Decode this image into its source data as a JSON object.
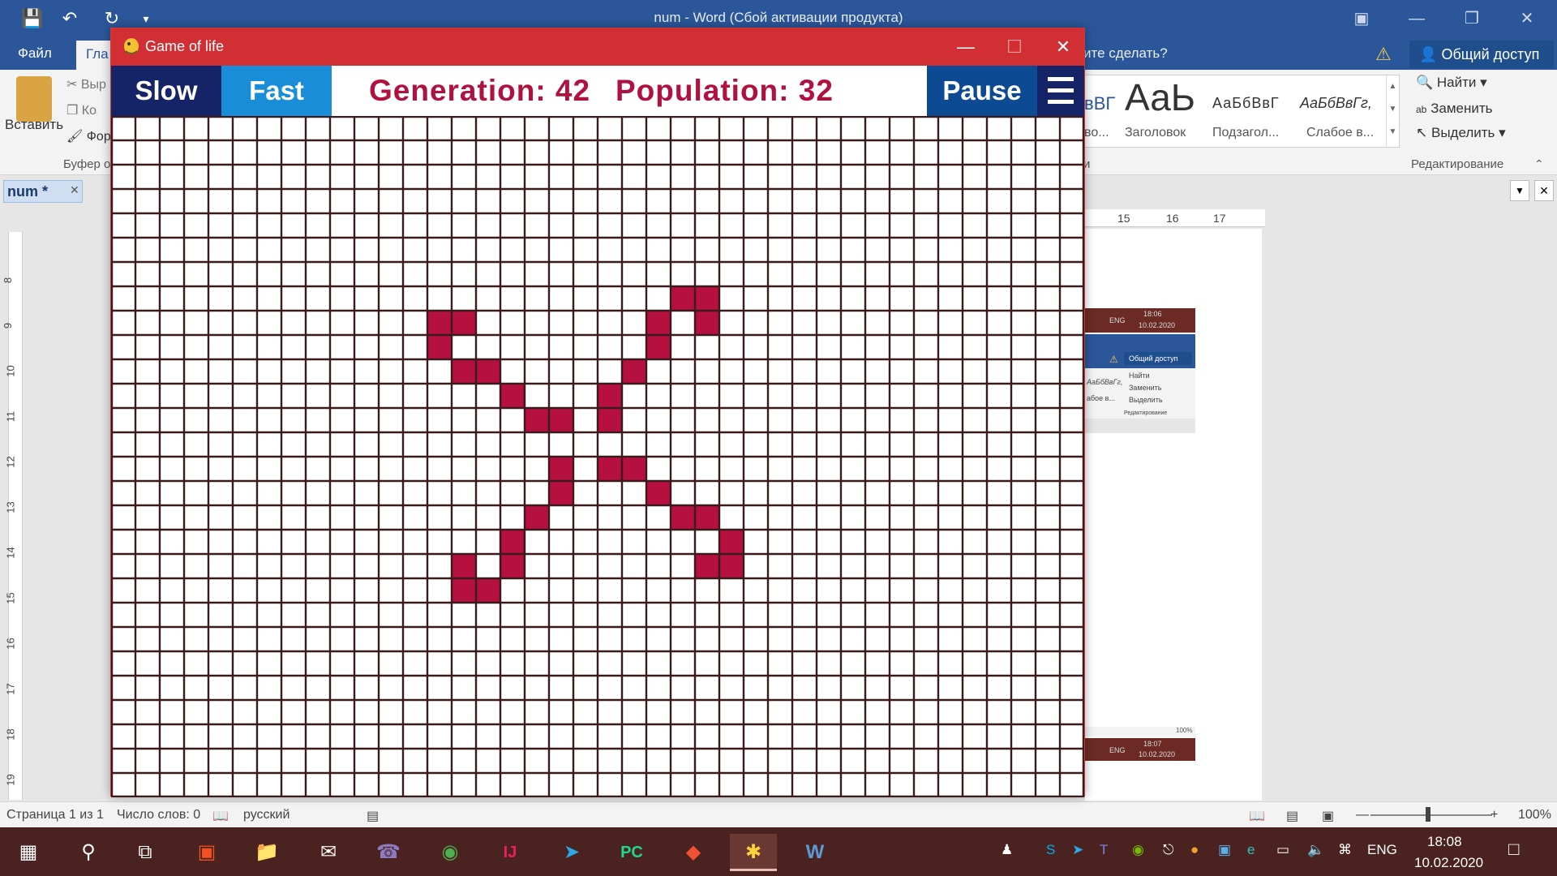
{
  "word": {
    "title": "num - Word (Сбой активации продукта)",
    "tabs": {
      "file": "Файл",
      "home": "Гла"
    },
    "tell_me": "ите сделать?",
    "share": "Общий доступ",
    "clipboard": {
      "paste": "Вставить",
      "cut": "Выр",
      "copy": "Ко",
      "format_painter": "Фор",
      "group": "Буфер о"
    },
    "styles": {
      "items": [
        {
          "sample": "вВГ",
          "name": "во..."
        },
        {
          "sample": "АаЬ",
          "name": "Заголовок"
        },
        {
          "sample": "АаБбВвГ",
          "name": "Подзагол..."
        },
        {
          "sample": "АаБбВвГг,",
          "name": "Слабое в..."
        }
      ],
      "group": "и"
    },
    "editing": {
      "find": "Найти",
      "replace": "Заменить",
      "select": "Выделить",
      "group": "Редактирование"
    },
    "document_tab": "num *",
    "ruler_h": [
      "15",
      "16",
      "17"
    ],
    "ruler_v": [
      "8",
      "9",
      "10",
      "11",
      "12",
      "13",
      "14",
      "15",
      "16",
      "17",
      "18",
      "19"
    ],
    "mini": {
      "time1": "18:06",
      "date1": "10.02.2020",
      "lang": "ENG",
      "share": "Общий доступ",
      "find": "Найти",
      "replace": "Заменить",
      "select": "Выделить",
      "group": "Редактирование",
      "sample": "АаБбВвГг,",
      "sample_name": "абое в...",
      "zoom": "100%",
      "time2": "18:07",
      "date2": "10.02.2020"
    },
    "status": {
      "page": "Страница 1 из 1",
      "words": "Число слов: 0",
      "lang": "русский",
      "zoom": "100%"
    }
  },
  "game": {
    "window_title": "Game of life",
    "buttons": {
      "slow": "Slow",
      "fast": "Fast",
      "pause": "Pause"
    },
    "generation": "Generation: 42",
    "population": "Population: 32",
    "colors": {
      "cell_alive": "#b5103f",
      "grid_line": "#3a1a1a",
      "slow_bg": "#142466",
      "fast_bg": "#1a8dd8",
      "pause_bg": "#0d4a94",
      "title_bar": "#d12f33"
    },
    "grid": {
      "cols": 40,
      "rows": 28,
      "alive_cells": [
        [
          23,
          7
        ],
        [
          24,
          7
        ],
        [
          13,
          8
        ],
        [
          14,
          8
        ],
        [
          22,
          8
        ],
        [
          24,
          8
        ],
        [
          13,
          9
        ],
        [
          22,
          9
        ],
        [
          14,
          10
        ],
        [
          15,
          10
        ],
        [
          21,
          10
        ],
        [
          16,
          11
        ],
        [
          20,
          11
        ],
        [
          17,
          12
        ],
        [
          18,
          12
        ],
        [
          20,
          12
        ],
        [
          18,
          14
        ],
        [
          20,
          14
        ],
        [
          21,
          14
        ],
        [
          18,
          15
        ],
        [
          22,
          15
        ],
        [
          17,
          16
        ],
        [
          23,
          16
        ],
        [
          24,
          16
        ],
        [
          16,
          17
        ],
        [
          25,
          17
        ],
        [
          14,
          18
        ],
        [
          16,
          18
        ],
        [
          24,
          18
        ],
        [
          25,
          18
        ],
        [
          14,
          19
        ],
        [
          15,
          19
        ]
      ]
    }
  },
  "taskbar": {
    "apps": [
      "windows-start",
      "search",
      "task-view",
      "store",
      "explorer",
      "mail",
      "viber",
      "chrome",
      "intellij",
      "telegram",
      "pycharm",
      "git",
      "python",
      "word"
    ],
    "tray": {
      "lang": "ENG",
      "time": "18:08",
      "date": "10.02.2020"
    }
  }
}
